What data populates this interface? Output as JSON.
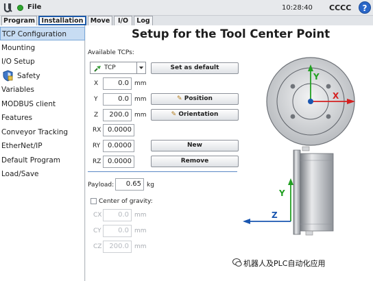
{
  "topbar": {
    "file_label": "File",
    "clock": "10:28:40",
    "robot_name": "CCCC",
    "help_glyph": "?"
  },
  "tabs": [
    {
      "label": "Program",
      "active": false
    },
    {
      "label": "Installation",
      "active": true
    },
    {
      "label": "Move",
      "active": false
    },
    {
      "label": "I/O",
      "active": false
    },
    {
      "label": "Log",
      "active": false
    }
  ],
  "sidebar": {
    "items": [
      {
        "label": "TCP Configuration",
        "selected": true
      },
      {
        "label": "Mounting"
      },
      {
        "label": "I/O Setup"
      },
      {
        "label": "Safety",
        "icon": "shield-icon"
      },
      {
        "label": "Variables"
      },
      {
        "label": "MODBUS client"
      },
      {
        "label": "Features"
      },
      {
        "label": "Conveyor Tracking"
      },
      {
        "label": "EtherNet/IP"
      },
      {
        "label": "Default Program"
      },
      {
        "label": "Load/Save"
      }
    ]
  },
  "main": {
    "title": "Setup for the Tool Center Point",
    "available_tcps_label": "Available TCPs:",
    "tcp_selected": "TCP",
    "buttons": {
      "set_default": "Set as default",
      "position": "Position",
      "orientation": "Orientation",
      "new": "New",
      "remove": "Remove"
    },
    "fields": {
      "x": {
        "label": "X",
        "value": "0.0",
        "unit": "mm"
      },
      "y": {
        "label": "Y",
        "value": "0.0",
        "unit": "mm"
      },
      "z": {
        "label": "Z",
        "value": "200.0",
        "unit": "mm"
      },
      "rx": {
        "label": "RX",
        "value": "0.0000"
      },
      "ry": {
        "label": "RY",
        "value": "0.0000"
      },
      "rz": {
        "label": "RZ",
        "value": "0.0000"
      }
    },
    "payload": {
      "label": "Payload:",
      "value": "0.65",
      "unit": "kg"
    },
    "cog": {
      "label": "Center of gravity:",
      "checked": false,
      "cx": {
        "label": "CX",
        "value": "0.0",
        "unit": "mm"
      },
      "cy": {
        "label": "CY",
        "value": "0.0",
        "unit": "mm"
      },
      "cz": {
        "label": "CZ",
        "value": "200.0",
        "unit": "mm"
      }
    },
    "diagram": {
      "top_view": {
        "y_label": "Y",
        "x_label": "X"
      },
      "side_view": {
        "y_label": "Y",
        "z_label": "Z"
      }
    }
  },
  "watermark": "机器人及PLC自动化应用",
  "colors": {
    "accent": "#1d5aa8",
    "axis_x": "#d42020",
    "axis_y": "#22a022",
    "axis_z": "#1a56b0",
    "status_ok": "#2fa52f"
  }
}
